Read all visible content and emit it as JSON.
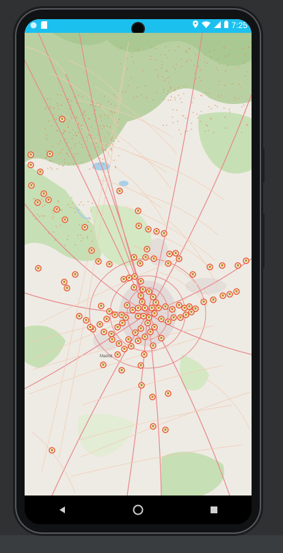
{
  "status_bar": {
    "time": "7:25",
    "left_icons": [
      "app-icon",
      "sd-card-icon"
    ],
    "right_icons": [
      "location-icon",
      "wifi-icon",
      "signal-icon",
      "battery-icon"
    ],
    "color": "#1cc0ef"
  },
  "map": {
    "base_colors": {
      "land": "#eeebe4",
      "forest": "#c7dfb4",
      "mountain": "#b9d1a2",
      "park": "#d5e8c4",
      "water": "#a9d0e8",
      "road_major": "#e8868a",
      "road_minor": "#f2c9b2",
      "urban": "#ddd6d6"
    },
    "marker_color": "#e85a37",
    "labels": [
      "Madrid"
    ],
    "marker_count": 114
  },
  "nav_bar": {
    "buttons": [
      "back-icon",
      "home-icon",
      "recents-icon"
    ]
  }
}
